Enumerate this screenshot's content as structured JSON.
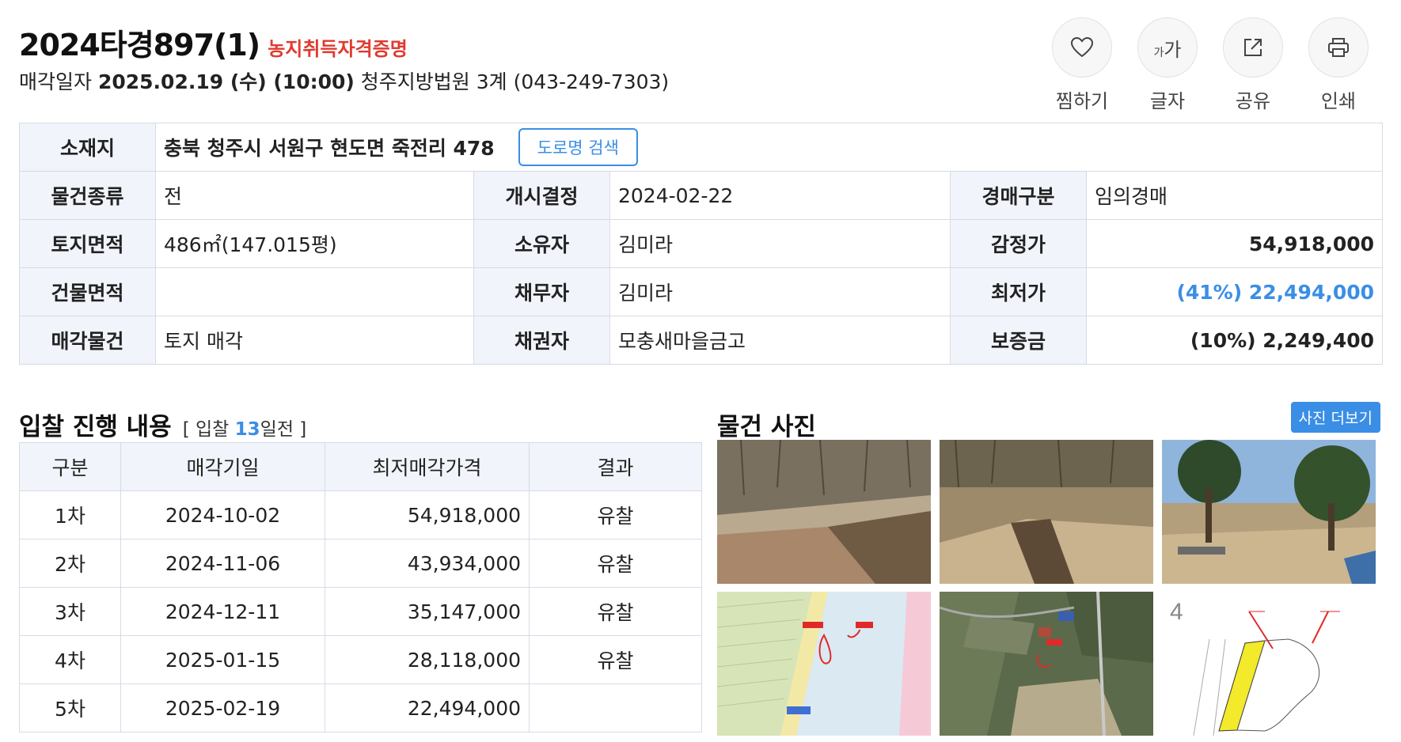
{
  "header": {
    "case_number": "2024타경897(1)",
    "certification": "농지취득자격증명",
    "sale_label": "매각일자",
    "sale_datetime": "2025.02.19 (수) (10:00)",
    "court": "청주지방법원 3계 (043-249-7303)"
  },
  "actions": {
    "like": "찜하기",
    "font_size": "글자",
    "font_icon_small": "가",
    "font_icon_large": "가",
    "share": "공유",
    "print": "인쇄"
  },
  "info": {
    "location_label": "소재지",
    "location_value": "충북 청주시 서원구 현도면 죽전리 478",
    "road_search_button": "도로명 검색",
    "rows": [
      {
        "l1": "물건종류",
        "v1": "전",
        "l2": "개시결정",
        "v2": "2024-02-22",
        "l3": "경매구분",
        "v3": "임의경매"
      },
      {
        "l1": "토지면적",
        "v1": "486㎡(147.015평)",
        "l2": "소유자",
        "v2": "김미라",
        "l3": "감정가",
        "v3": "54,918,000"
      },
      {
        "l1": "건물면적",
        "v1": "",
        "l2": "채무자",
        "v2": "김미라",
        "l3": "최저가",
        "v3": "(41%) 22,494,000"
      },
      {
        "l1": "매각물건",
        "v1": "토지 매각",
        "l2": "채권자",
        "v2": "모충새마을금고",
        "l3": "보증금",
        "v3": "(10%) 2,249,400"
      }
    ]
  },
  "bidding": {
    "title": "입찰 진행 내용",
    "meta_prefix": "[ 입찰 ",
    "days": "13",
    "meta_suffix": "일전 ]",
    "headers": [
      "구분",
      "매각기일",
      "최저매각가격",
      "결과"
    ],
    "rows": [
      {
        "round": "1차",
        "date": "2024-10-02",
        "price": "54,918,000",
        "result": "유찰"
      },
      {
        "round": "2차",
        "date": "2024-11-06",
        "price": "43,934,000",
        "result": "유찰"
      },
      {
        "round": "3차",
        "date": "2024-12-11",
        "price": "35,147,000",
        "result": "유찰"
      },
      {
        "round": "4차",
        "date": "2025-01-15",
        "price": "28,118,000",
        "result": "유찰"
      },
      {
        "round": "5차",
        "date": "2025-02-19",
        "price": "22,494,000",
        "result": ""
      }
    ]
  },
  "photos": {
    "title": "물건 사진",
    "more_button": "사진 더보기"
  },
  "colors": {
    "accent": "#3a8ee6",
    "cert_red": "#e03a2f",
    "header_bg": "#f1f4fa",
    "border": "#d6dbe4"
  },
  "icons": [
    "heart-icon",
    "share-icon",
    "print-icon"
  ]
}
